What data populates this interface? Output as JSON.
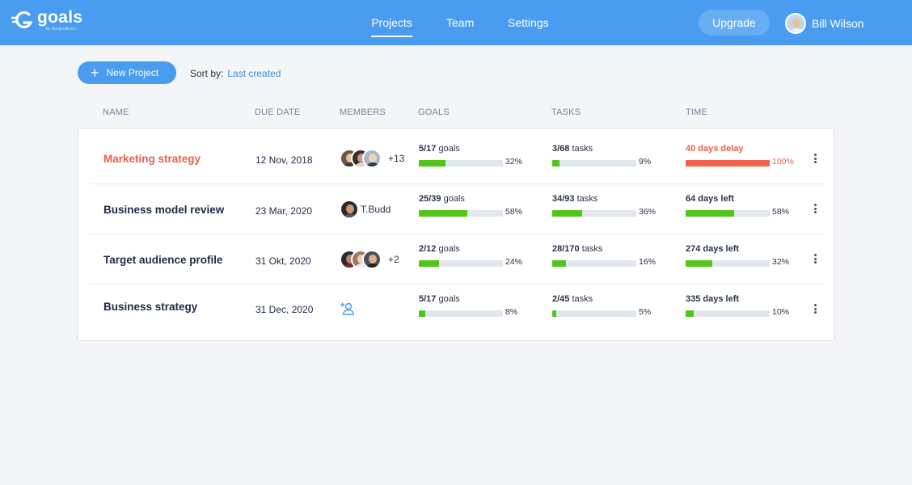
{
  "brand": {
    "name": "goals",
    "tagline": "by Keepsolid Inc."
  },
  "nav": [
    {
      "label": "Projects",
      "active": true
    },
    {
      "label": "Team",
      "active": false
    },
    {
      "label": "Settings",
      "active": false
    }
  ],
  "header": {
    "upgrade_label": "Upgrade",
    "user_name": "Bill Wilson"
  },
  "toolbar": {
    "new_project_label": "New Project",
    "sort_label": "Sort by:",
    "sort_value": "Last created"
  },
  "columns": {
    "name": "NAME",
    "due": "DUE DATE",
    "members": "MEMBERS",
    "goals": "GOALS",
    "tasks": "TASKS",
    "time": "TIME"
  },
  "colors": {
    "accent": "#4a9cf0",
    "progress": "#52c41a",
    "danger": "#f2614e",
    "track": "#e2e6ee"
  },
  "projects": [
    {
      "name": "Marketing strategy",
      "overdue": true,
      "due": "12 Nov, 2018",
      "members_text": "+13",
      "goals": {
        "count": "5/17",
        "word": "goals",
        "pct": "32%",
        "value": 32
      },
      "tasks": {
        "count": "3/68",
        "word": "tasks",
        "pct": "9%",
        "value": 9
      },
      "time": {
        "label": "40 days delay",
        "pct": "100%",
        "value": 100
      }
    },
    {
      "name": "Business model review",
      "overdue": false,
      "due": "23 Mar, 2020",
      "members_text": "T.Budd",
      "goals": {
        "count": "25/39",
        "word": "goals",
        "pct": "58%",
        "value": 58
      },
      "tasks": {
        "count": "34/93",
        "word": "tasks",
        "pct": "36%",
        "value": 36
      },
      "time": {
        "label": "64 days left",
        "pct": "58%",
        "value": 58
      }
    },
    {
      "name": "Target audience profile",
      "overdue": false,
      "due": "31 Okt, 2020",
      "members_text": "+2",
      "goals": {
        "count": "2/12",
        "word": "goals",
        "pct": "24%",
        "value": 24
      },
      "tasks": {
        "count": "28/170",
        "word": "tasks",
        "pct": "16%",
        "value": 16
      },
      "time": {
        "label": "274 days left",
        "pct": "32%",
        "value": 32
      }
    },
    {
      "name": "Business strategy",
      "overdue": false,
      "due": "31 Dec, 2020",
      "members_text": "",
      "goals": {
        "count": "5/17",
        "word": "goals",
        "pct": "8%",
        "value": 8
      },
      "tasks": {
        "count": "2/45",
        "word": "tasks",
        "pct": "5%",
        "value": 5
      },
      "time": {
        "label": "335 days left",
        "pct": "10%",
        "value": 10
      }
    }
  ]
}
